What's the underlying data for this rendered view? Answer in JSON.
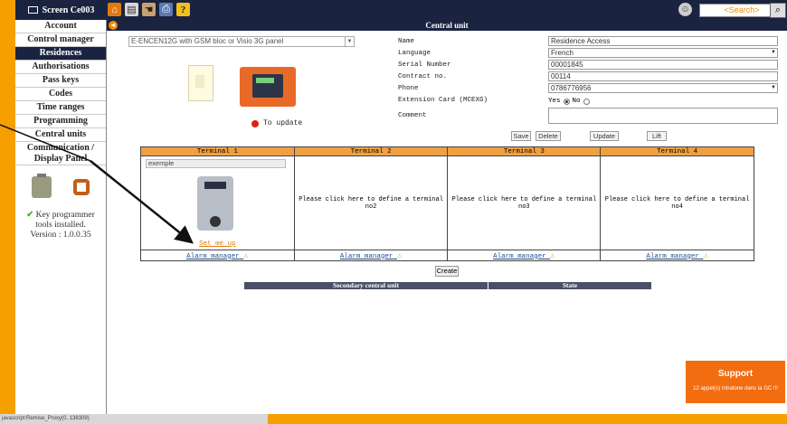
{
  "topbar": {
    "screen_title": "Screen Ce003",
    "search_placeholder": "<Search>",
    "tool_icons": [
      "home-icon",
      "document-icon",
      "hand-icon",
      "print-icon",
      "help-icon"
    ]
  },
  "sidebar": {
    "items": [
      {
        "label": "Account"
      },
      {
        "label": "Control manager"
      },
      {
        "label": "Residences",
        "active": true
      },
      {
        "label": "Authorisations"
      },
      {
        "label": "Pass keys"
      },
      {
        "label": "Codes"
      },
      {
        "label": "Time ranges"
      },
      {
        "label": "Programming"
      },
      {
        "label": "Central units"
      },
      {
        "label": "Communication / Display Panel"
      }
    ],
    "key_info": {
      "line1": "Key programmer tools installed.",
      "line2": "Version : 1.0.0.35"
    }
  },
  "main": {
    "header": "Central unit",
    "panel_select": "E-ENCEN12G with GSM bloc or Visio 3G panel",
    "update_label": "To update",
    "form": {
      "name_label": "Name",
      "name_value": "Residence Access",
      "language_label": "Language",
      "language_value": "French",
      "serial_label": "Serial Number",
      "serial_value": "00001845",
      "contract_label": "Contract no.",
      "contract_value": "00114",
      "phone_label": "Phone",
      "phone_value": "0786776956",
      "extension_label": "Extension Card (MCEXG)",
      "extension_yes": "Yes",
      "extension_no": "No",
      "comment_label": "Comment"
    },
    "buttons": {
      "save": "Save",
      "delete": "Delete",
      "update": "Update",
      "lift": "Lift",
      "create": "Create"
    },
    "terminals": {
      "headers": [
        "Terminal 1",
        "Terminal 2",
        "Terminal 3",
        "Terminal 4"
      ],
      "t1_name": "exemple",
      "t1_setup": "Set me up",
      "t2_text": "Please click here to define a terminal no2",
      "t3_text": "Please click here to define a terminal no3",
      "t4_text": "Please click here to define a terminal no4",
      "alarm_label": "Alarm manager"
    },
    "secondary": {
      "col1": "Secondary central unit",
      "col2": "State"
    },
    "support": {
      "title": "Support",
      "subtitle": "12 appel(s) Intratone dans la GC !!!"
    }
  },
  "statusbar": {
    "text": "javascript:Remise_Proxy(0, 138309)"
  },
  "colors": {
    "frame": "#f5a000",
    "navy": "#1a2340",
    "terminal_header": "#f0a040",
    "support": "#f26c10"
  }
}
